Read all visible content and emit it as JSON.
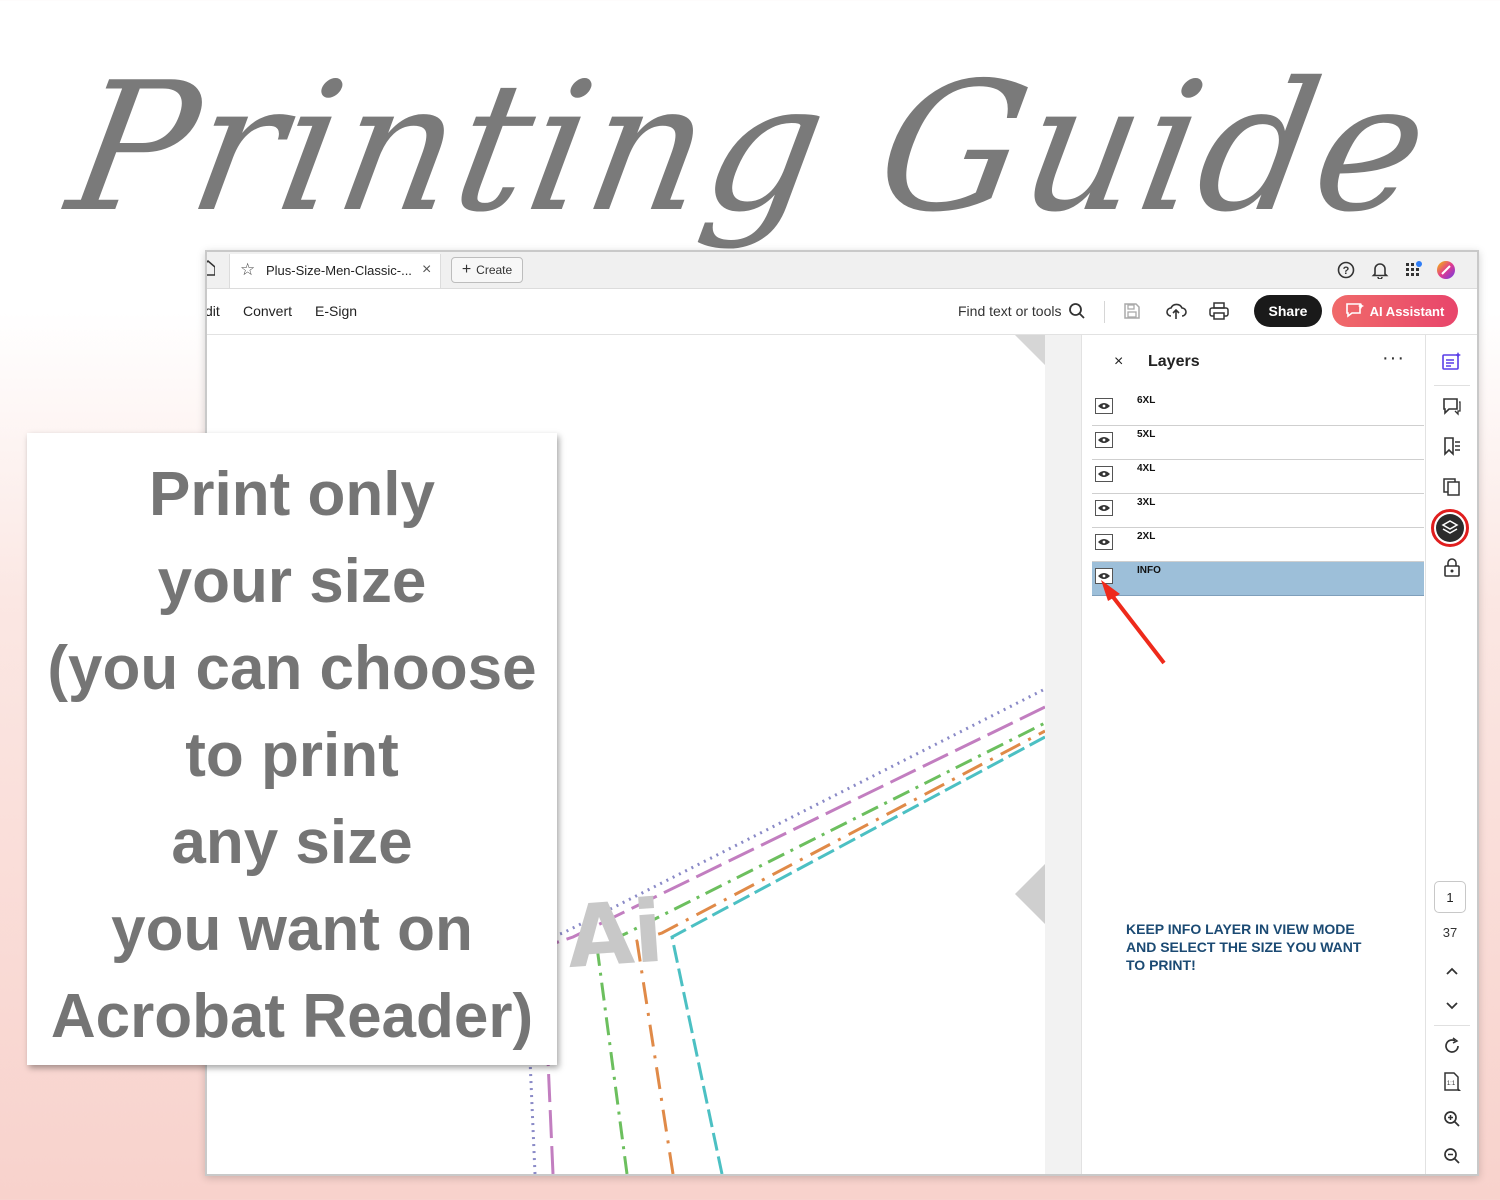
{
  "guide_title": "Printing Guide",
  "callout": {
    "text": "Print only\nyour size\n(you can choose\nto print\nany size\nyou want on\nAcrobat Reader)"
  },
  "tabbar": {
    "home_stub_icon": "home-icon",
    "tab_title": "Plus-Size-Men-Classic-...",
    "tab_star_icon": "star-icon",
    "tab_close": "×",
    "create_label": "Create",
    "right_icons": [
      "help-icon",
      "bell-icon",
      "apps-grid-icon",
      "profile-icon"
    ]
  },
  "toolbar": {
    "menu_items": [
      "dit",
      "Convert",
      "E-Sign"
    ],
    "find_label": "Find text or tools",
    "share_label": "Share",
    "ai_assistant_label": "AI Assistant"
  },
  "document": {
    "watermark": "Ai",
    "pattern_colors": {
      "size_6xl": "#8a8ac7",
      "size_5xl": "#c27ec0",
      "size_4xl": "#6cbf5e",
      "size_3xl": "#e08a48",
      "size_2xl": "#4cc0c3"
    }
  },
  "layers_panel": {
    "title": "Layers",
    "close": "×",
    "more": "···",
    "layers": [
      {
        "name": "6XL",
        "selected": false
      },
      {
        "name": "5XL",
        "selected": false
      },
      {
        "name": "4XL",
        "selected": false
      },
      {
        "name": "3XL",
        "selected": false
      },
      {
        "name": "2XL",
        "selected": false
      },
      {
        "name": "INFO",
        "selected": true
      }
    ],
    "note": "KEEP INFO LAYER IN VIEW MODE\nAND SELECT THE SIZE YOU WANT\nTO PRINT!",
    "selected_row_color": "#9dbfd9",
    "note_color": "#1b4a73",
    "arrow_color": "#ee2a1b"
  },
  "right_rail": {
    "current_page": "1",
    "total_pages": "37"
  }
}
